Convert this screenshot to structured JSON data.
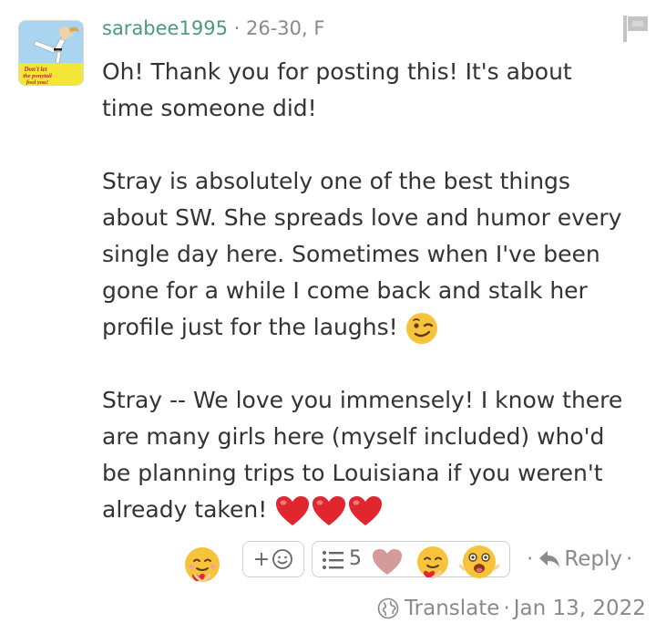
{
  "comment": {
    "username": "sarabee1995",
    "separator": "·",
    "age_gender": "26-30, F",
    "avatar_icon": "karate-girl-avatar",
    "avatar_caption": [
      "Don't let",
      "the ponytail",
      "fool you!"
    ],
    "paragraphs": [
      [
        "Oh! Thank you for posting this! It's about",
        "time someone did!"
      ],
      [
        "Stray is absolutely one of the best things",
        "about SW. She spreads love and humor every",
        "single day here. Sometimes when I've been",
        "gone for a while I come back and stalk her",
        "profile just for the laughs!"
      ],
      [
        "Stray -- We love you immensely! I know there",
        "are many girls here (myself included) who'd",
        "be planning trips to Louisiana if you weren't",
        "already taken!"
      ]
    ],
    "wink_emoji": "winking-face-emoji",
    "heart_emojis": [
      "red-heart",
      "red-heart",
      "red-heart"
    ]
  },
  "actions": {
    "main_reaction": "hugging-face-reaction",
    "add_reaction_label": "+",
    "add_reaction_icon": "smiley-icon",
    "reactions_list_icon": "list-icon",
    "reaction_count": "5",
    "reaction_icons": [
      "pink-heart",
      "hugging-face",
      "excited-face"
    ],
    "reply_prefix": "·",
    "reply_label": "Reply",
    "reply_suffix": "·",
    "translate_label": "Translate",
    "date_separator": "·",
    "date": "Jan 13, 2022"
  },
  "colors": {
    "username": "#4a9a7c",
    "meta": "#8a8a8a",
    "text": "#333333",
    "heart": "#e0262f",
    "emoji_yellow": "#f6c33a",
    "border": "#cfcfcf"
  }
}
